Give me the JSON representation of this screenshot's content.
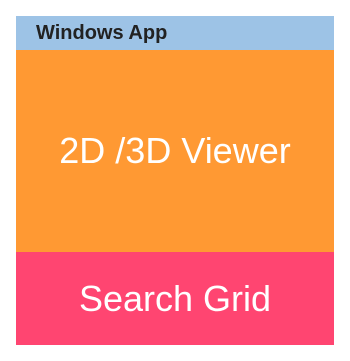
{
  "window": {
    "title": "Windows App"
  },
  "panels": {
    "viewer_label": "2D /3D Viewer",
    "grid_label": "Search Grid"
  },
  "colors": {
    "title_bar": "#9dc3e6",
    "viewer": "#ff9933",
    "grid": "#ff4571",
    "label_text": "#ffffff"
  }
}
